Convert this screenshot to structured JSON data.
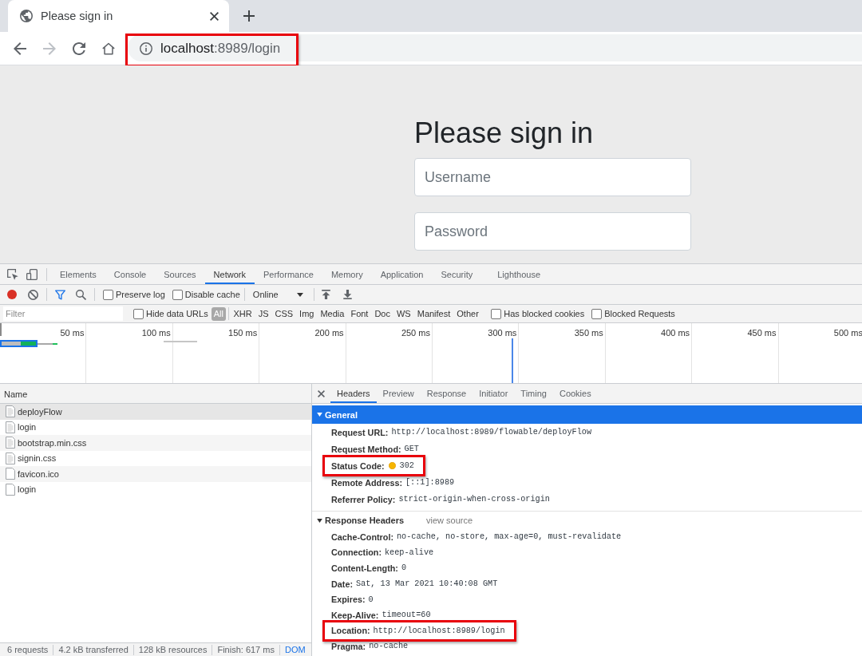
{
  "browser": {
    "tabs": [
      {
        "title": "Please sign in",
        "selected": true
      }
    ],
    "nav_buttons": [
      {
        "kind": "back",
        "disabled": false
      },
      {
        "kind": "forward",
        "disabled": true
      },
      {
        "kind": "reload",
        "disabled": false
      },
      {
        "kind": "home",
        "disabled": false
      }
    ],
    "address_bar": {
      "host": "localhost",
      "path": ":8989/login",
      "highlighted": true
    }
  },
  "page": {
    "heading": "Please sign in",
    "fields": [
      {
        "placeholder": "Username"
      },
      {
        "placeholder": "Password"
      }
    ]
  },
  "devtools": {
    "panel_tabs": [
      {
        "label": "Elements",
        "selected": false
      },
      {
        "label": "Console",
        "selected": false
      },
      {
        "label": "Sources",
        "selected": false
      },
      {
        "label": "Network",
        "selected": true
      },
      {
        "label": "Performance",
        "selected": false
      },
      {
        "label": "Memory",
        "selected": false
      },
      {
        "label": "Application",
        "selected": false
      },
      {
        "label": "Security",
        "selected": false
      },
      {
        "label": "Lighthouse",
        "selected": false
      }
    ],
    "toolbar": {
      "buttons": [
        {
          "kind": "record",
          "on": true
        },
        {
          "kind": "clear",
          "on": false
        },
        {
          "kind": "filter",
          "on": true
        },
        {
          "kind": "search",
          "on": false
        }
      ],
      "checkboxes": [
        {
          "label": "Preserve log",
          "checked": false
        },
        {
          "label": "Disable cache",
          "checked": false
        }
      ],
      "throttling": "Online"
    },
    "filter_bar": {
      "placeholder": "Filter",
      "checkbox": {
        "label": "Hide data URLs",
        "checked": false
      },
      "types": [
        {
          "label": "All",
          "selected": true
        },
        {
          "label": "XHR",
          "selected": false
        },
        {
          "label": "JS",
          "selected": false
        },
        {
          "label": "CSS",
          "selected": false
        },
        {
          "label": "Img",
          "selected": false
        },
        {
          "label": "Media",
          "selected": false
        },
        {
          "label": "Font",
          "selected": false
        },
        {
          "label": "Doc",
          "selected": false
        },
        {
          "label": "WS",
          "selected": false
        },
        {
          "label": "Manifest",
          "selected": false
        },
        {
          "label": "Other",
          "selected": false
        }
      ],
      "extra_checkboxes": [
        {
          "label": "Has blocked cookies",
          "checked": false
        },
        {
          "label": "Blocked Requests",
          "checked": false
        }
      ]
    },
    "timeline": {
      "tick_labels": [
        "50 ms",
        "100 ms",
        "150 ms",
        "200 ms",
        "250 ms",
        "300 ms",
        "350 ms",
        "400 ms",
        "450 ms",
        "500 ms"
      ]
    },
    "requests": {
      "column": "Name",
      "rows": [
        {
          "name": "deployFlow",
          "kind": "document",
          "selected": true
        },
        {
          "name": "login",
          "kind": "document",
          "selected": false
        },
        {
          "name": "bootstrap.min.css",
          "kind": "document",
          "selected": false
        },
        {
          "name": "signin.css",
          "kind": "document",
          "selected": false
        },
        {
          "name": "favicon.ico",
          "kind": "blank",
          "selected": false
        },
        {
          "name": "login",
          "kind": "blank",
          "selected": false
        }
      ],
      "summary": [
        {
          "text": "6 requests",
          "kind": "plain"
        },
        {
          "text": "4.2 kB transferred",
          "kind": "plain"
        },
        {
          "text": "128 kB resources",
          "kind": "plain"
        },
        {
          "text": "Finish: 617 ms",
          "kind": "plain"
        },
        {
          "text": "DOM",
          "kind": "link"
        }
      ]
    },
    "details": {
      "tabs": [
        {
          "label": "Headers",
          "selected": true
        },
        {
          "label": "Preview",
          "selected": false
        },
        {
          "label": "Response",
          "selected": false
        },
        {
          "label": "Initiator",
          "selected": false
        },
        {
          "label": "Timing",
          "selected": false
        },
        {
          "label": "Cookies",
          "selected": false
        }
      ],
      "sections": [
        {
          "title": "General",
          "expanded": true,
          "selected": true,
          "headers": [
            {
              "name": "Request URL:",
              "value": "http://localhost:8989/flowable/deployFlow",
              "kind": "plain",
              "highlighted": false
            },
            {
              "name": "Request Method:",
              "value": "GET",
              "kind": "plain",
              "highlighted": false
            },
            {
              "name": "Status Code:",
              "value": "302",
              "kind": "status",
              "highlighted": true
            },
            {
              "name": "Remote Address:",
              "value": "[::1]:8989",
              "kind": "plain",
              "highlighted": false
            },
            {
              "name": "Referrer Policy:",
              "value": "strict-origin-when-cross-origin",
              "kind": "plain",
              "highlighted": false
            }
          ]
        },
        {
          "title": "Response Headers",
          "expanded": true,
          "selected": false,
          "link": "view source",
          "headers": [
            {
              "name": "Cache-Control:",
              "value": "no-cache, no-store, max-age=0, must-revalidate",
              "highlighted": false
            },
            {
              "name": "Connection:",
              "value": "keep-alive",
              "highlighted": false
            },
            {
              "name": "Content-Length:",
              "value": "0",
              "highlighted": false
            },
            {
              "name": "Date:",
              "value": "Sat, 13 Mar 2021 10:40:08 GMT",
              "highlighted": false
            },
            {
              "name": "Expires:",
              "value": "0",
              "highlighted": false
            },
            {
              "name": "Keep-Alive:",
              "value": "timeout=60",
              "highlighted": false
            },
            {
              "name": "Location:",
              "value": "http://localhost:8989/login",
              "highlighted": true
            },
            {
              "name": "Pragma:",
              "value": "no-cache",
              "highlighted": false
            }
          ]
        }
      ]
    }
  }
}
